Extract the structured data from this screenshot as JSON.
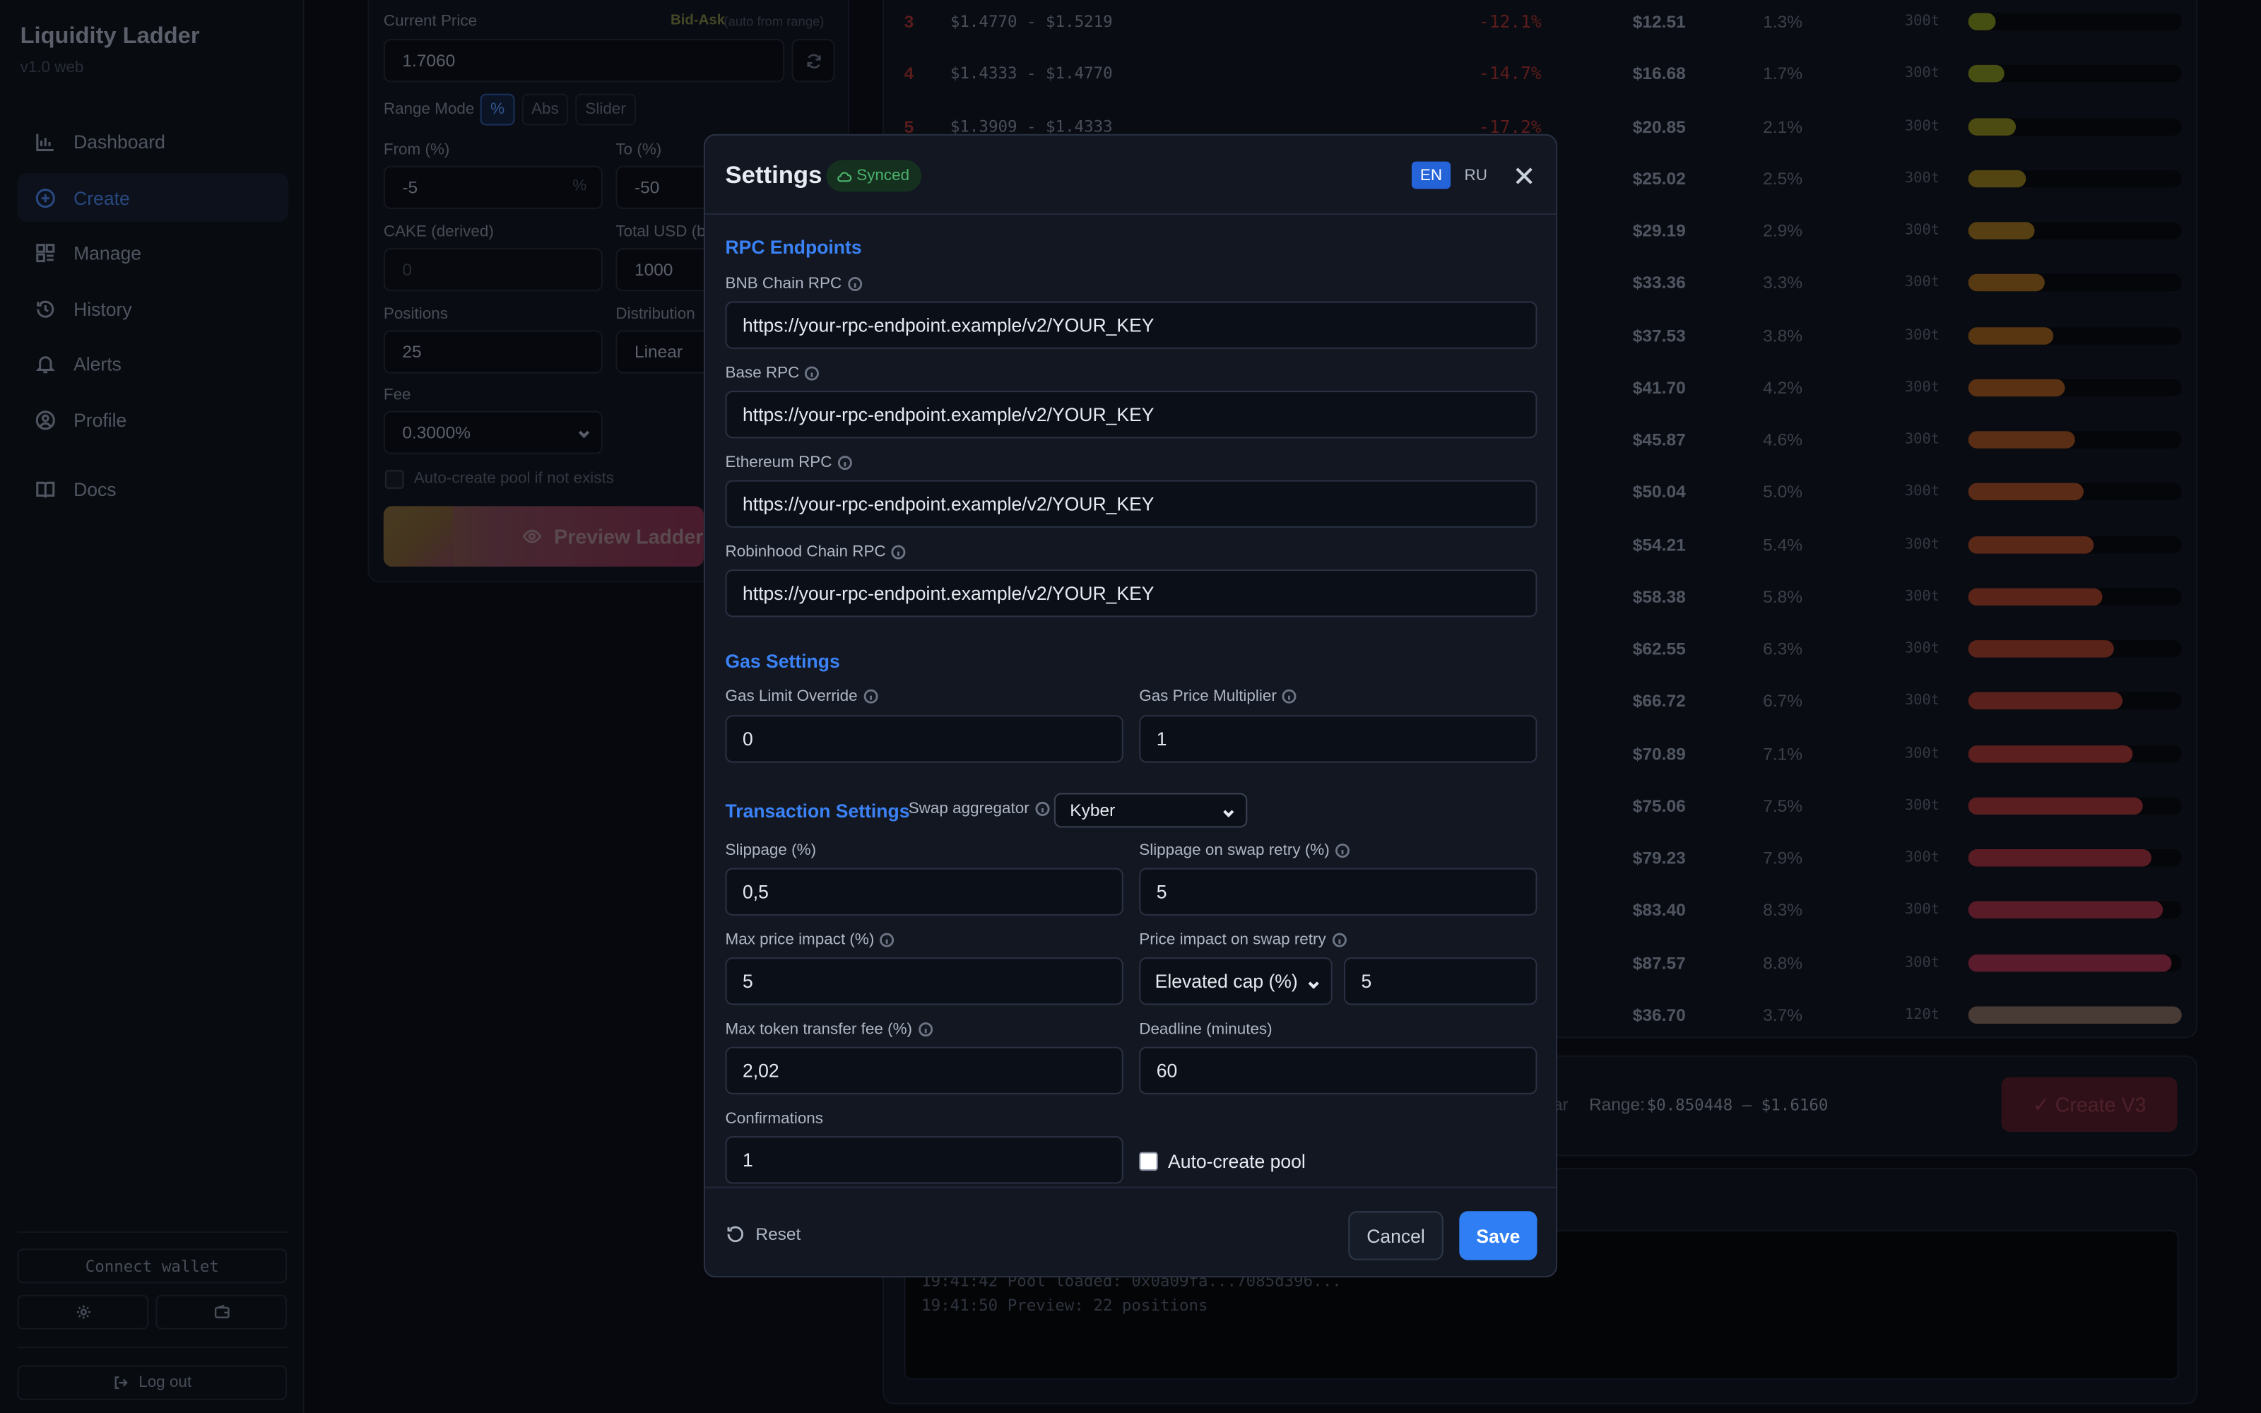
{
  "app": {
    "name": "Liquidity Ladder",
    "version": "v1.0 web"
  },
  "sidebar": {
    "items": [
      {
        "label": "Dashboard",
        "icon": "bar-chart-icon"
      },
      {
        "label": "Create",
        "icon": "plus-circle-icon",
        "active": true
      },
      {
        "label": "Manage",
        "icon": "grid-icon"
      },
      {
        "label": "History",
        "icon": "history-icon"
      },
      {
        "label": "Alerts",
        "icon": "bell-icon"
      },
      {
        "label": "Profile",
        "icon": "user-circle-icon"
      },
      {
        "label": "Docs",
        "icon": "book-icon"
      }
    ],
    "connect_wallet": "Connect wallet",
    "log_out": "Log out"
  },
  "form": {
    "current_price_label": "Current Price",
    "bid_ask": "Bid-Ask",
    "bid_ask_note": "(auto from range)",
    "current_price": "1.7060",
    "range_mode_label": "Range Mode",
    "range_modes": [
      "%",
      "Abs",
      "Slider"
    ],
    "from_label": "From (%)",
    "from_value": "-5",
    "from_suffix": "%",
    "to_label": "To (%)",
    "to_value": "-50",
    "cake_label": "CAKE (derived)",
    "cake_value": "0",
    "total_usd_label": "Total USD (bu",
    "total_usd_value": "1000",
    "positions_label": "Positions",
    "positions_value": "25",
    "distribution_label": "Distribution",
    "distribution_value": "Linear",
    "fee_label": "Fee",
    "fee_value": "0.3000%",
    "auto_create_label": "Auto-create pool if not exists",
    "preview_button": "Preview Ladder"
  },
  "table": {
    "rows": [
      {
        "idx": "3",
        "range": "$1.4770 - $1.5219",
        "pct": "-12.1%",
        "usd": "$12.51",
        "share": "1.3%",
        "tick": "300t",
        "fill": 0.13,
        "color": "#6a7a1c"
      },
      {
        "idx": "4",
        "range": "$1.4333 - $1.4770",
        "pct": "-14.7%",
        "usd": "$16.68",
        "share": "1.7%",
        "tick": "300t",
        "fill": 0.17,
        "color": "#6d7a1c"
      },
      {
        "idx": "5",
        "range": "$1.3909 - $1.4333",
        "pct": "-17.2%",
        "usd": "$20.85",
        "share": "2.1%",
        "tick": "300t",
        "fill": 0.22,
        "color": "#76741c"
      },
      {
        "idx": "",
        "range": "",
        "pct": "",
        "usd": "$25.02",
        "share": "2.5%",
        "tick": "300t",
        "fill": 0.27,
        "color": "#7f6a1c"
      },
      {
        "idx": "",
        "range": "",
        "pct": "",
        "usd": "$29.19",
        "share": "2.9%",
        "tick": "300t",
        "fill": 0.31,
        "color": "#84621c"
      },
      {
        "idx": "",
        "range": "",
        "pct": "",
        "usd": "$33.36",
        "share": "3.3%",
        "tick": "300t",
        "fill": 0.36,
        "color": "#875a1c"
      },
      {
        "idx": "",
        "range": "",
        "pct": "",
        "usd": "$37.53",
        "share": "3.8%",
        "tick": "300t",
        "fill": 0.4,
        "color": "#89541c"
      },
      {
        "idx": "",
        "range": "",
        "pct": "",
        "usd": "$41.70",
        "share": "4.2%",
        "tick": "300t",
        "fill": 0.45,
        "color": "#8a4e1e"
      },
      {
        "idx": "",
        "range": "",
        "pct": "",
        "usd": "$45.87",
        "share": "4.6%",
        "tick": "300t",
        "fill": 0.5,
        "color": "#8b4820"
      },
      {
        "idx": "",
        "range": "",
        "pct": "",
        "usd": "$50.04",
        "share": "5.0%",
        "tick": "300t",
        "fill": 0.54,
        "color": "#8b4322"
      },
      {
        "idx": "",
        "range": "",
        "pct": "",
        "usd": "$54.21",
        "share": "5.4%",
        "tick": "300t",
        "fill": 0.59,
        "color": "#8b3e24"
      },
      {
        "idx": "",
        "range": "",
        "pct": "",
        "usd": "$58.38",
        "share": "5.8%",
        "tick": "300t",
        "fill": 0.63,
        "color": "#8b3a26"
      },
      {
        "idx": "",
        "range": "",
        "pct": "",
        "usd": "$62.55",
        "share": "6.3%",
        "tick": "300t",
        "fill": 0.68,
        "color": "#8b3628"
      },
      {
        "idx": "",
        "range": "",
        "pct": "",
        "usd": "$66.72",
        "share": "6.7%",
        "tick": "300t",
        "fill": 0.72,
        "color": "#8b332b"
      },
      {
        "idx": "",
        "range": "",
        "pct": "",
        "usd": "$70.89",
        "share": "7.1%",
        "tick": "300t",
        "fill": 0.77,
        "color": "#8b302f"
      },
      {
        "idx": "",
        "range": "",
        "pct": "",
        "usd": "$75.06",
        "share": "7.5%",
        "tick": "300t",
        "fill": 0.82,
        "color": "#8b2e33"
      },
      {
        "idx": "",
        "range": "",
        "pct": "",
        "usd": "$79.23",
        "share": "7.9%",
        "tick": "300t",
        "fill": 0.86,
        "color": "#8b2c38"
      },
      {
        "idx": "",
        "range": "",
        "pct": "",
        "usd": "$83.40",
        "share": "8.3%",
        "tick": "300t",
        "fill": 0.91,
        "color": "#8b2a3e"
      },
      {
        "idx": "",
        "range": "",
        "pct": "",
        "usd": "$87.57",
        "share": "8.8%",
        "tick": "300t",
        "fill": 0.95,
        "color": "#8b2a45"
      },
      {
        "idx": "",
        "range": "",
        "pct": "",
        "usd": "$36.70",
        "share": "3.7%",
        "tick": "120t",
        "fill": 1.0,
        "color": "#6f5a52"
      }
    ]
  },
  "summary": {
    "left_text": "ar",
    "range_label": "Range:",
    "range_value": "$0.850448 — $1.6160",
    "create_button": "✓ Create V3"
  },
  "log": {
    "lines": [
      "19:41:42 Pool loaded: 0x0a09fa...7085d396...",
      "19:41:50 Preview: 22 positions"
    ]
  },
  "modal": {
    "title": "Settings",
    "synced": "Synced",
    "lang_en": "EN",
    "lang_ru": "RU",
    "rpc_section": "RPC Endpoints",
    "bnb_label": "BNB Chain RPC",
    "bnb_value": "https://your-rpc-endpoint.example/v2/YOUR_KEY",
    "base_label": "Base RPC",
    "base_value": "https://your-rpc-endpoint.example/v2/YOUR_KEY",
    "eth_label": "Ethereum RPC",
    "eth_value": "https://your-rpc-endpoint.example/v2/YOUR_KEY",
    "robin_label": "Robinhood Chain RPC",
    "robin_value": "https://your-rpc-endpoint.example/v2/YOUR_KEY",
    "gas_section": "Gas Settings",
    "gas_limit_label": "Gas Limit Override",
    "gas_limit_value": "0",
    "gas_mult_label": "Gas Price Multiplier",
    "gas_mult_value": "1",
    "tx_section": "Transaction Settings",
    "swap_agg_label": "Swap aggregator",
    "swap_agg_value": "Kyber",
    "slippage_label": "Slippage (%)",
    "slippage_value": "0,5",
    "slip_retry_label": "Slippage on swap retry (%)",
    "slip_retry_value": "5",
    "max_impact_label": "Max price impact (%)",
    "max_impact_value": "5",
    "impact_retry_label": "Price impact on swap retry",
    "impact_retry_mode": "Elevated cap (%)",
    "impact_retry_value": "5",
    "max_fee_label": "Max token transfer fee (%)",
    "max_fee_value": "2,02",
    "deadline_label": "Deadline (minutes)",
    "deadline_value": "60",
    "confirmations_label": "Confirmations",
    "confirmations_value": "1",
    "auto_pool_label": "Auto-create pool",
    "reset": "Reset",
    "cancel": "Cancel",
    "save": "Save"
  },
  "colors": {
    "accent": "#3b82f6",
    "save": "#2f7ef3",
    "synced": "#49b26a",
    "negative": "#8a2b2b"
  }
}
